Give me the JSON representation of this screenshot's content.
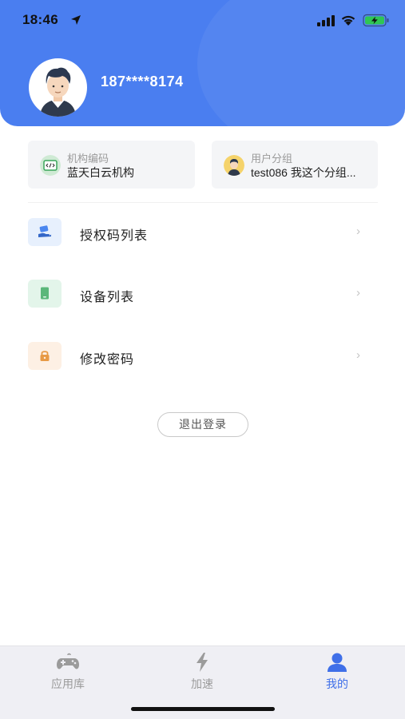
{
  "status_bar": {
    "time": "18:46"
  },
  "profile": {
    "phone": "187****8174",
    "avatar_icon": "user-avatar"
  },
  "info_cards": [
    {
      "label": "机构编码",
      "value": "蓝天白云机构",
      "icon": "code-icon"
    },
    {
      "label": "用户分组",
      "value": "test086 我这个分组...",
      "icon": "user-avatar-icon"
    }
  ],
  "menu": [
    {
      "label": "授权码列表",
      "icon": "hand-card-icon",
      "icon_bg": "#e7f0fd",
      "chevron": "›"
    },
    {
      "label": "设备列表",
      "icon": "device-icon",
      "icon_bg": "#e3f5ea",
      "chevron": "›"
    },
    {
      "label": "修改密码",
      "icon": "lock-icon",
      "icon_bg": "#fdf0e4",
      "chevron": "›"
    }
  ],
  "logout_label": "退出登录",
  "tabbar": [
    {
      "label": "应用库",
      "icon": "gamepad-icon",
      "active": false
    },
    {
      "label": "加速",
      "icon": "lightning-icon",
      "active": false
    },
    {
      "label": "我的",
      "icon": "person-icon",
      "active": true
    }
  ],
  "colors": {
    "brand": "#4a7ef0",
    "tab_active": "#3f6fe8"
  }
}
